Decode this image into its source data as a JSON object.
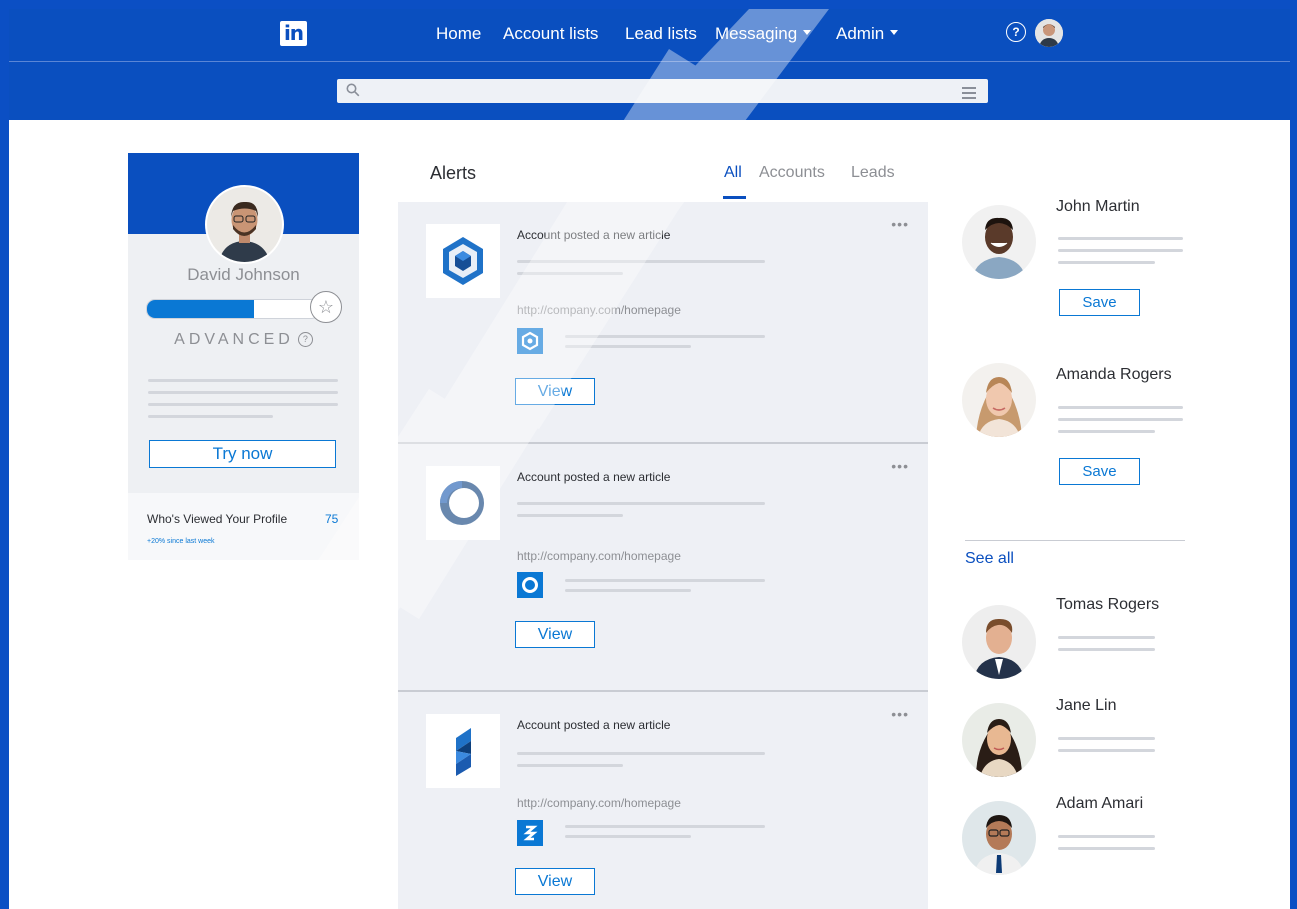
{
  "colors": {
    "brand": "#0a4fbf",
    "accent": "#0a78d4",
    "card_bg": "#eef0f5",
    "muted_text": "#8d8f94"
  },
  "header": {
    "logo_text": "in",
    "nav": [
      {
        "label": "Home",
        "has_caret": false
      },
      {
        "label": "Account lists",
        "has_caret": false
      },
      {
        "label": "Lead lists",
        "has_caret": false
      },
      {
        "label": "Messaging",
        "has_caret": true
      },
      {
        "label": "Admin",
        "has_caret": true
      }
    ],
    "help_icon": "?",
    "search": {
      "value": "",
      "placeholder": ""
    }
  },
  "profile": {
    "name": "David Johnson",
    "level": "ADVANCED",
    "level_progress": 0.62,
    "cta_label": "Try now",
    "viewed_label": "Who's Viewed Your Profile",
    "viewed_count": "75",
    "viewed_delta": "+20% since last week"
  },
  "alerts": {
    "title": "Alerts",
    "tabs": [
      {
        "label": "All",
        "active": true
      },
      {
        "label": "Accounts",
        "active": false
      },
      {
        "label": "Leads",
        "active": false
      }
    ],
    "items": [
      {
        "title": "Account posted a new article",
        "url": "http://company.com/homepage",
        "button": "View",
        "more": "•••",
        "logo_icon": "hexagon-cube-icon"
      },
      {
        "title": "Account posted a new article",
        "url": "http://company.com/homepage",
        "button": "View",
        "more": "•••",
        "logo_icon": "ring-icon"
      },
      {
        "title": "Account posted a new article",
        "url": "http://company.com/homepage",
        "button": "View",
        "more": "•••",
        "logo_icon": "s-shape-icon"
      }
    ]
  },
  "suggestions": {
    "people": [
      {
        "name": "John Martin",
        "action": "Save"
      },
      {
        "name": "Amanda Rogers",
        "action": "Save"
      }
    ],
    "see_all_label": "See all",
    "more_people": [
      {
        "name": "Tomas Rogers"
      },
      {
        "name": "Jane Lin"
      },
      {
        "name": "Adam Amari"
      }
    ]
  }
}
